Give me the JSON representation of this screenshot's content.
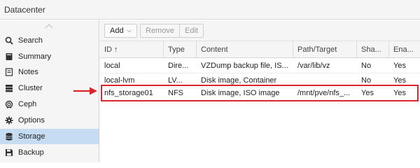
{
  "window": {
    "title": "Datacenter"
  },
  "sidebar": {
    "items": [
      {
        "label": "Search",
        "icon": "search-icon"
      },
      {
        "label": "Summary",
        "icon": "book-icon"
      },
      {
        "label": "Notes",
        "icon": "note-icon"
      },
      {
        "label": "Cluster",
        "icon": "server-icon"
      },
      {
        "label": "Ceph",
        "icon": "ceph-icon"
      },
      {
        "label": "Options",
        "icon": "gear-icon"
      },
      {
        "label": "Storage",
        "icon": "database-icon",
        "active": true
      },
      {
        "label": "Backup",
        "icon": "floppy-icon"
      }
    ]
  },
  "toolbar": {
    "add_label": "Add",
    "remove_label": "Remove",
    "edit_label": "Edit"
  },
  "table": {
    "columns": [
      "ID ↑",
      "Type",
      "Content",
      "Path/Target",
      "Sha...",
      "Ena..."
    ],
    "rows": [
      [
        "local",
        "Dire...",
        "VZDump backup file, IS...",
        "/var/lib/vz",
        "No",
        "Yes"
      ],
      [
        "local-lvm",
        "LV...",
        "Disk image, Container",
        "",
        "No",
        "Yes"
      ],
      [
        "nfs_storage01",
        "NFS",
        "Disk image, ISO image",
        "/mnt/pve/nfs_...",
        "Yes",
        "Yes"
      ]
    ]
  },
  "colors": {
    "highlight": "#d9262c",
    "selected_nav": "#c6dcf3"
  }
}
